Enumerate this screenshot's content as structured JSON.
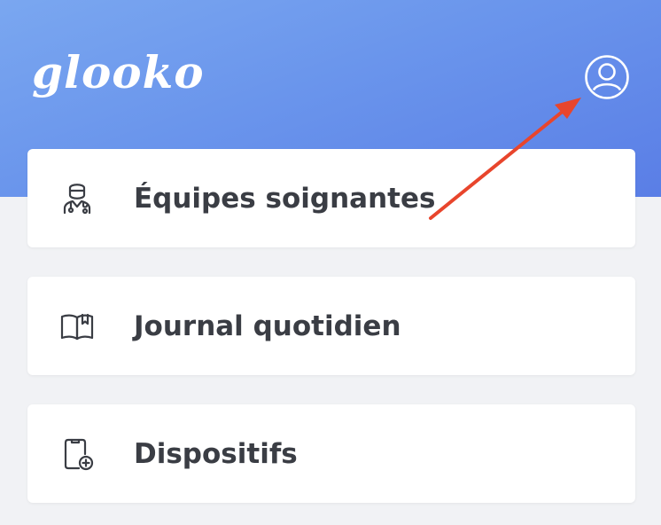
{
  "header": {
    "logo_text": "glooko",
    "profile_icon": "user-circle-icon",
    "background_colors": [
      "#7aa7f0",
      "#5a7ee6"
    ]
  },
  "menu": {
    "items": [
      {
        "label": "Équipes soignantes",
        "icon": "doctor-icon"
      },
      {
        "label": "Journal quotidien",
        "icon": "book-icon"
      },
      {
        "label": "Dispositifs",
        "icon": "device-add-icon"
      }
    ]
  },
  "annotation": {
    "arrow_color": "#e8452c"
  }
}
